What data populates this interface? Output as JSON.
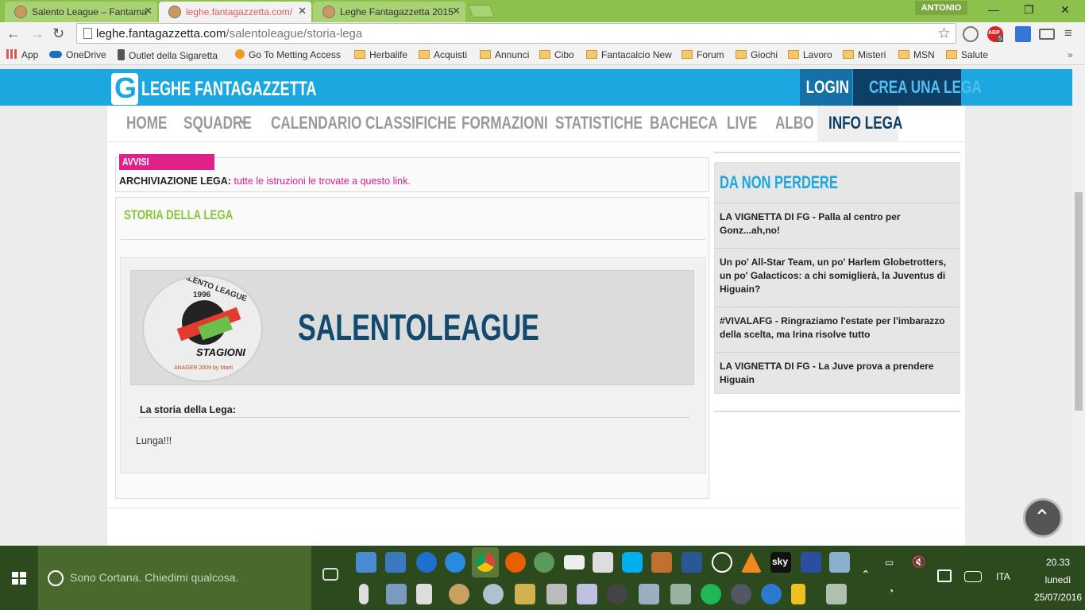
{
  "browser": {
    "tabs": [
      {
        "title": "Salento League – Fantama"
      },
      {
        "title": "leghe.fantagazzetta.com/"
      },
      {
        "title": "Leghe Fantagazzetta 2015"
      }
    ],
    "user": "ANTONIO",
    "url_host": "leghe.fantagazzetta.com",
    "url_path": "/salentoleague/storia-lega",
    "bookmarks": [
      {
        "label": "App"
      },
      {
        "label": "OneDrive"
      },
      {
        "label": "Outlet della Sigaretta"
      },
      {
        "label": "Go To Metting Access"
      },
      {
        "label": "Herbalife"
      },
      {
        "label": "Acquisti"
      },
      {
        "label": "Annunci"
      },
      {
        "label": "Cibo"
      },
      {
        "label": "Fantacalcio New"
      },
      {
        "label": "Forum"
      },
      {
        "label": "Giochi"
      },
      {
        "label": "Lavoro"
      },
      {
        "label": "Misteri"
      },
      {
        "label": "MSN"
      },
      {
        "label": "Salute"
      }
    ],
    "abp_count": "5"
  },
  "site": {
    "logo_text": "LEGHE FANTAGAZZETTA",
    "login": "LOGIN",
    "crea": "CREA UNA LEGA",
    "nav": [
      "HOME",
      "SQUADRE",
      "CALENDARIO",
      "CLASSIFICHE",
      "FORMAZIONI",
      "STATISTICHE",
      "BACHECA",
      "LIVE",
      "ALBO",
      "INFO LEGA"
    ],
    "active_nav": "INFO LEGA"
  },
  "avvisi": {
    "label": "AVVISI",
    "bold": "ARCHIVIAZIONE LEGA:",
    "link": "tutte le istruzioni le trovate a questo link."
  },
  "storia": {
    "title": "STORIA DELLA LEGA",
    "league_name": "SALENTOLEAGUE",
    "logo_top": "SALENTO LEAGUE",
    "logo_year": "1996",
    "logo_stagioni": "STAGIONI",
    "logo_bottom": "ANAGER 2009 by Marti",
    "subtitle": "La storia della Lega:",
    "body": "Lunga!!!"
  },
  "sidebar": {
    "title": "DA NON PERDERE",
    "news": [
      "LA VIGNETTA DI FG - Palla al centro per Gonz...ah,no!",
      "Un po' All-Star Team, un po' Harlem Globetrotters, un po' Galacticos: a chi somiglierà, la Juventus di Higuain?",
      "#VIVALAFG - Ringraziamo l'estate per l'imbarazzo della scelta, ma Irina risolve tutto",
      "LA VIGNETTA DI FG - La Juve prova a prendere Higuain"
    ]
  },
  "taskbar": {
    "cortana": "Sono Cortana. Chiedimi qualcosa.",
    "time": "20.33",
    "day": "lunedì",
    "date": "25/07/2016",
    "lang": "ITA"
  },
  "colors": {
    "site_blue": "#1ca7e0",
    "nav_dark": "#0e3f66",
    "accent_pink": "#e0218a",
    "green_title": "#8bc43f",
    "taskbar": "#2d4a1e"
  }
}
